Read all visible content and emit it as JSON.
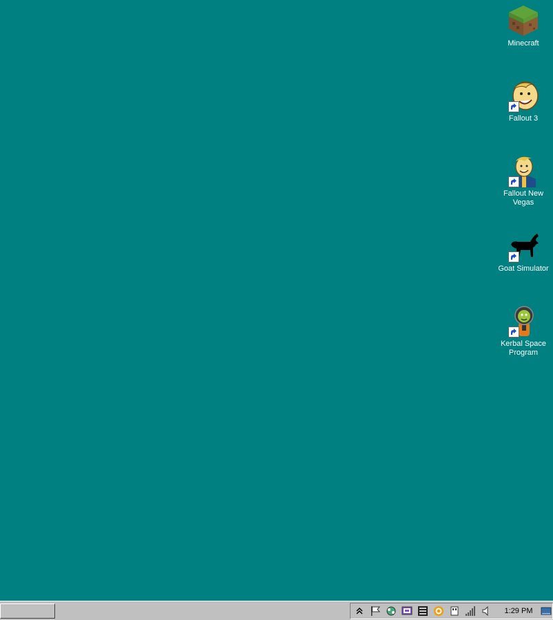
{
  "desktop": {
    "background_color": "#008080",
    "icons": [
      {
        "label": "Minecraft",
        "icon": "minecraft-grass-block-icon",
        "shortcut": false
      },
      {
        "label": "Fallout 3",
        "icon": "vault-boy-icon",
        "shortcut": true
      },
      {
        "label": "Fallout New Vegas",
        "icon": "vault-boy-jacket-icon",
        "shortcut": true
      },
      {
        "label": "Goat Simulator",
        "icon": "goat-silhouette-icon",
        "shortcut": true
      },
      {
        "label": "Kerbal Space Program",
        "icon": "kerbal-astronaut-icon",
        "shortcut": true
      }
    ]
  },
  "taskbar": {
    "start_button_label": "",
    "tray_icons": [
      "show-hidden-icons-chevron",
      "action-center-flag-icon",
      "steam-network-icon",
      "display-settings-icon",
      "film-strip-icon",
      "orange-circle-app-icon",
      "usb-device-icon",
      "network-signal-icon",
      "volume-speaker-icon"
    ],
    "clock": "1:29 PM",
    "show_desktop_icon": "show-desktop-icon"
  }
}
